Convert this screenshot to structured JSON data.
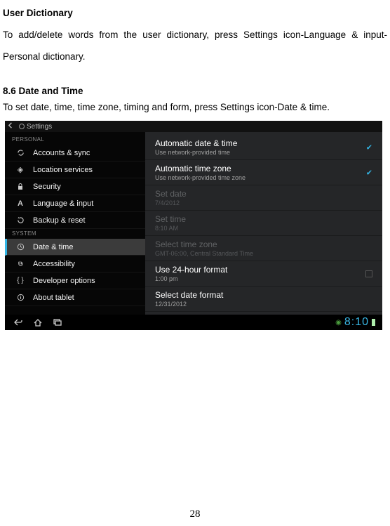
{
  "doc": {
    "userDictHeading": "User Dictionary",
    "userDictPara": "To add/delete words from the user dictionary, press Settings icon-Language & input-Personal dictionary.",
    "dateTimeHeading": "8.6 Date and Time",
    "dateTimePara": "To set date, time, time zone, timing and form, press Settings icon-Date & time.",
    "pageNumber": "28"
  },
  "screenshot": {
    "statusbarTitle": "Settings",
    "sidebar": {
      "sectionPersonal": "PERSONAL",
      "sectionSystem": "SYSTEM",
      "items": {
        "accounts": "Accounts & sync",
        "location": "Location services",
        "security": "Security",
        "language": "Language & input",
        "backup": "Backup & reset",
        "datetime": "Date & time",
        "accessibility": "Accessibility",
        "developer": "Developer options",
        "about": "About tablet"
      }
    },
    "content": {
      "autoDateTitle": "Automatic date & time",
      "autoDateSub": "Use network-provided time",
      "autoZoneTitle": "Automatic time zone",
      "autoZoneSub": "Use network-provided time zone",
      "setDateTitle": "Set date",
      "setDateSub": "7/4/2012",
      "setTimeTitle": "Set time",
      "setTimeSub": "8:10 AM",
      "setZoneTitle": "Select time zone",
      "setZoneSub": "GMT-06:00, Central Standard Time",
      "use24Title": "Use 24-hour format",
      "use24Sub": "1:00 pm",
      "dateFmtTitle": "Select date format",
      "dateFmtSub": "12/31/2012"
    },
    "navbar": {
      "clock": "8:10"
    }
  }
}
